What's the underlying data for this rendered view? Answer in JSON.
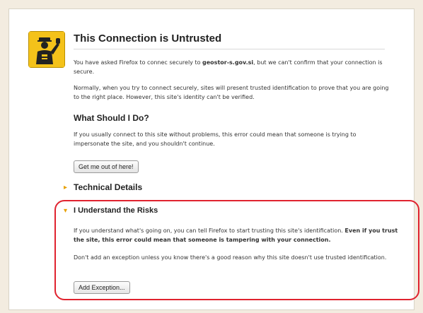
{
  "page": {
    "title": "This Connection is Untrusted",
    "intro_pre": "You have asked Firefox to connec securely to ",
    "intro_host": "geostor-s.gov.si",
    "intro_post": ", but we can't confirm that your connection is secure.",
    "normally_text": "Normally, when you try to connect securely, sites will present trusted identification to prove that you are going to the right place. However, this site's identity can't be verified.",
    "what_heading": "What Should I Do?",
    "what_text": "If you usually connect to this site without problems, this error could mean that someone is trying to impersonate the site, and you shouldn't continue.",
    "get_me_out_label": "Get me out of here!",
    "tech_heading": "Technical Details",
    "risk_heading": "I Understand the Risks",
    "risk_text_pre": "If you understand what's going on, you can tell Firefox to start trusting this site's identification. ",
    "risk_text_bold": "Even if you trust the site, this error could mean that someone is tampering with your connection.",
    "risk_text2": "Don't add an exception unless you know there's a good reason why this site doesn't use trusted identification.",
    "add_exception_label": "Add Exception..."
  },
  "icon": {
    "name": "officer-warning-icon",
    "color": "#f4c21a"
  },
  "colors": {
    "highlight_border": "#e0232f",
    "bullet": "#e8a000"
  }
}
